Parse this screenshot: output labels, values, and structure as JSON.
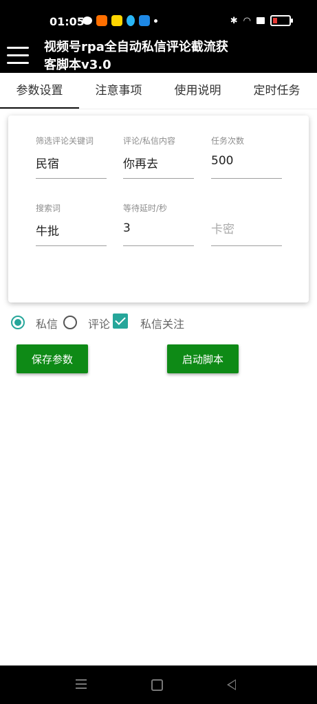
{
  "status": {
    "time": "01:05",
    "battery_color": "#e53935"
  },
  "app_bar": {
    "title": "视频号rpa全自动私信评论截流获客脚本v3.0"
  },
  "tabs": [
    {
      "label": "参数设置",
      "active": true
    },
    {
      "label": "注意事项",
      "active": false
    },
    {
      "label": "使用说明",
      "active": false
    },
    {
      "label": "定时任务",
      "active": false
    }
  ],
  "form": {
    "keyword": {
      "label": "筛选评论关键词",
      "value": "民宿"
    },
    "content": {
      "label": "评论/私信内容",
      "value": "你再去"
    },
    "count": {
      "label": "任务次数",
      "value": "500"
    },
    "search": {
      "label": "搜索词",
      "value": "牛批"
    },
    "delay": {
      "label": "等待延时/秒",
      "value": "3"
    },
    "card_key": {
      "placeholder": "卡密"
    }
  },
  "options": {
    "private_msg": "私信",
    "comment": "评论",
    "follow": "私信关注"
  },
  "buttons": {
    "save": "保存参数",
    "start": "启动脚本"
  },
  "colors": {
    "accent": "#26a69a",
    "button": "#0e8a16"
  }
}
